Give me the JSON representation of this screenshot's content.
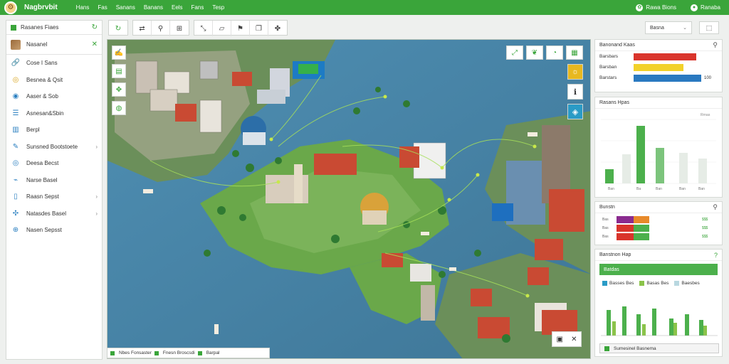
{
  "app": {
    "brand": "Nagbrvbit"
  },
  "topnav": [
    "Hans",
    "Fas",
    "Sanans",
    "Banans",
    "Eels",
    "Fans",
    "Tesp"
  ],
  "top_right": {
    "notifications": "Rawa Bions",
    "account": "Ranaba"
  },
  "sidebar": {
    "header": "Rasanes Fiaes",
    "sub_title": "Nasanel",
    "items": [
      {
        "label": "Cose I Sans",
        "icon": "link-icon"
      },
      {
        "label": "Besnea & Qsit",
        "icon": "coins-icon"
      },
      {
        "label": "Aaser & Sob",
        "icon": "eye-icon"
      },
      {
        "label": "Asnesan&Sbin",
        "icon": "list-icon"
      },
      {
        "label": "Berpl",
        "icon": "bar-chart-icon"
      },
      {
        "label": "Sunsned Bootstoete",
        "icon": "pen-icon"
      },
      {
        "label": "Deesa Becst",
        "icon": "target-icon"
      },
      {
        "label": "Narse Basel",
        "icon": "chart-icon"
      },
      {
        "label": "Raasn Sepst",
        "icon": "columns-icon"
      },
      {
        "label": "Natasdes Basel",
        "icon": "network-icon"
      },
      {
        "label": "Nasen Sepsst",
        "icon": "compass-icon"
      }
    ]
  },
  "toolbar": {
    "search_placeholder": "Basna",
    "groups": [
      [
        "refresh-icon"
      ],
      [
        "route-icon",
        "pin-icon",
        "grid-icon"
      ],
      [
        "arrows-icon",
        "layers-icon",
        "flag-icon",
        "copy-icon",
        "puzzle-icon"
      ]
    ]
  },
  "panels": {
    "p1": {
      "title": "Banonand Kaas",
      "rows": [
        {
          "label": "Barsbars",
          "value": 0.88,
          "color": "#d9342b",
          "text": ""
        },
        {
          "label": "Barsban",
          "value": 0.7,
          "color": "#f2d12a",
          "text": ""
        },
        {
          "label": "Barstars",
          "value": 0.95,
          "color": "#2a79c0",
          "text": "100"
        }
      ]
    },
    "p2": {
      "title": "Rasans Hpas",
      "legend": "Rrnas"
    },
    "p3": {
      "title": "Bunstn"
    },
    "p4": {
      "title": "Banstnon Hap",
      "strip": "Batdas",
      "legend": [
        "Basses Bes",
        "Basas Bes",
        "Baesbes"
      ],
      "footer": "Sumesinel Basnema"
    }
  },
  "statusbar": [
    "Nbes Fonsaster",
    "Fnesn Broscsdi",
    "Barpal"
  ],
  "colors": {
    "accent": "#3aa53a",
    "water": "#4a86a8",
    "land": "#6aa84a"
  }
}
